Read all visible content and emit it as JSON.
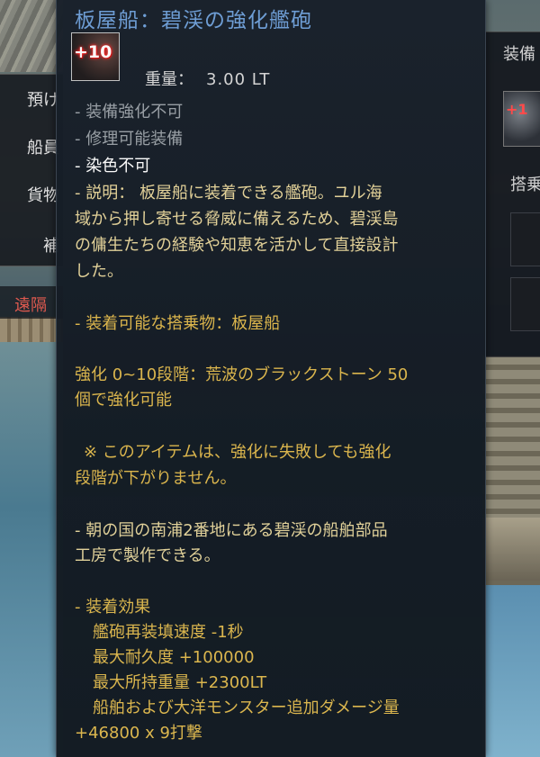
{
  "tooltip": {
    "title": "板屋船：碧渓の強化艦砲",
    "enhancement_badge": "+10",
    "weight_label": "重量：",
    "weight_value": "3.00 LT",
    "flags": [
      "- 装備強化不可",
      "- 修理可能装備",
      "- 染色不可"
    ],
    "description": [
      "- 説明： 板屋船に装着できる艦砲。ユル海",
      "域から押し寄せる脅威に備えるため、碧渓島",
      "の傭生たちの経験や知恵を活かして直接設計",
      "した。"
    ],
    "equippable": "- 装着可能な搭乗物：板屋船",
    "enhancement_info": [
      "強化 0~10段階：荒波のブラックストーン 50",
      "個で強化可能"
    ],
    "notice": [
      "※ このアイテムは、強化に失敗しても強化",
      "段階が下がりません。"
    ],
    "crafting": [
      "- 朝の国の南浦2番地にある碧渓の船舶部品",
      "工房で製作できる。"
    ],
    "effects_header": "- 装着効果",
    "effects": [
      "艦砲再装填速度 -1秒",
      "最大耐久度 +100000",
      "最大所持重量 +2300LT",
      "船舶および大洋モンスター追加ダメージ量"
    ],
    "effects_tail": "+46800 x 9打撃"
  },
  "left_menu": {
    "items": [
      "預け",
      "船員",
      "貨物",
      "補"
    ],
    "active": "遠隔"
  },
  "right_panel": {
    "title": "装備",
    "icon_badge": "+1",
    "subtitle": "搭乗"
  },
  "colors": {
    "title": "#6f9fd8",
    "gold_text": "#e0b84c",
    "gray_text": "#9aa0a6",
    "active_menu": "#e05a4f"
  }
}
